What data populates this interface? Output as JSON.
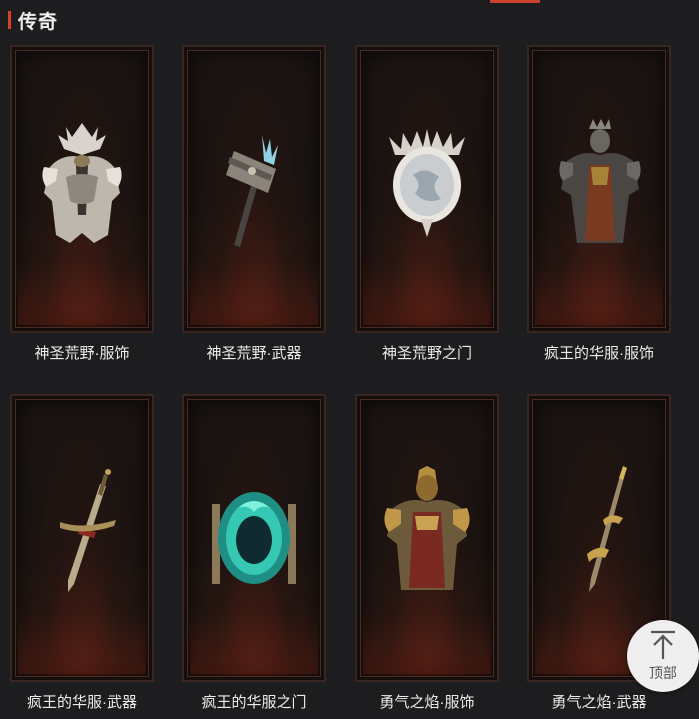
{
  "section": {
    "title": "传奇"
  },
  "items": [
    {
      "name": "神圣荒野·服饰",
      "icon": "armor-icon"
    },
    {
      "name": "神圣荒野·武器",
      "icon": "hammer-icon"
    },
    {
      "name": "神圣荒野之门",
      "icon": "mirror-portal-icon"
    },
    {
      "name": "疯王的华服·服饰",
      "icon": "armor-icon"
    },
    {
      "name": "疯王的华服·武器",
      "icon": "sword-icon"
    },
    {
      "name": "疯王的华服之门",
      "icon": "portal-icon"
    },
    {
      "name": "勇气之焰·服饰",
      "icon": "armor-icon"
    },
    {
      "name": "勇气之焰·武器",
      "icon": "sword-icon"
    }
  ],
  "back_to_top": {
    "label": "顶部",
    "icon": "arrow-up-icon"
  },
  "colors": {
    "accent": "#d8402c",
    "background": "#1d1d1f",
    "frame_border": "#4a2b22"
  }
}
